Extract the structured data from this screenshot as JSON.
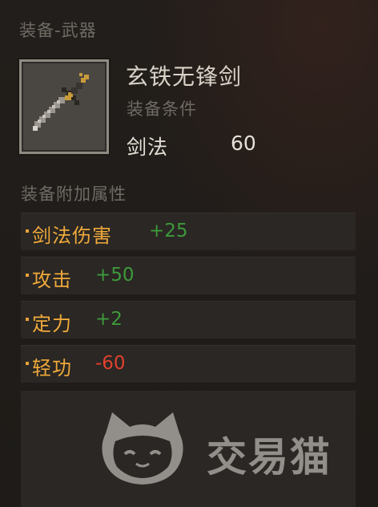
{
  "header": {
    "title": "装备-武器"
  },
  "item": {
    "name": "玄铁无锋剑",
    "icon": "sword-icon",
    "requirement_title": "装备条件",
    "requirement": {
      "label": "剑法",
      "value": "60"
    }
  },
  "bonus": {
    "title": "装备附加属性",
    "attributes": [
      {
        "name": "剑法伤害",
        "value": "+25",
        "type": "positive"
      },
      {
        "name": "攻击",
        "value": "+50",
        "type": "positive"
      },
      {
        "name": "定力",
        "value": "+2",
        "type": "positive"
      },
      {
        "name": "轻功",
        "value": "-60",
        "type": "negative"
      }
    ]
  },
  "watermark": {
    "text": "交易猫",
    "icon": "cat-logo-icon"
  },
  "colors": {
    "attr_name": "#f0a93a",
    "positive": "#3d9a3a",
    "negative": "#e0412e"
  }
}
